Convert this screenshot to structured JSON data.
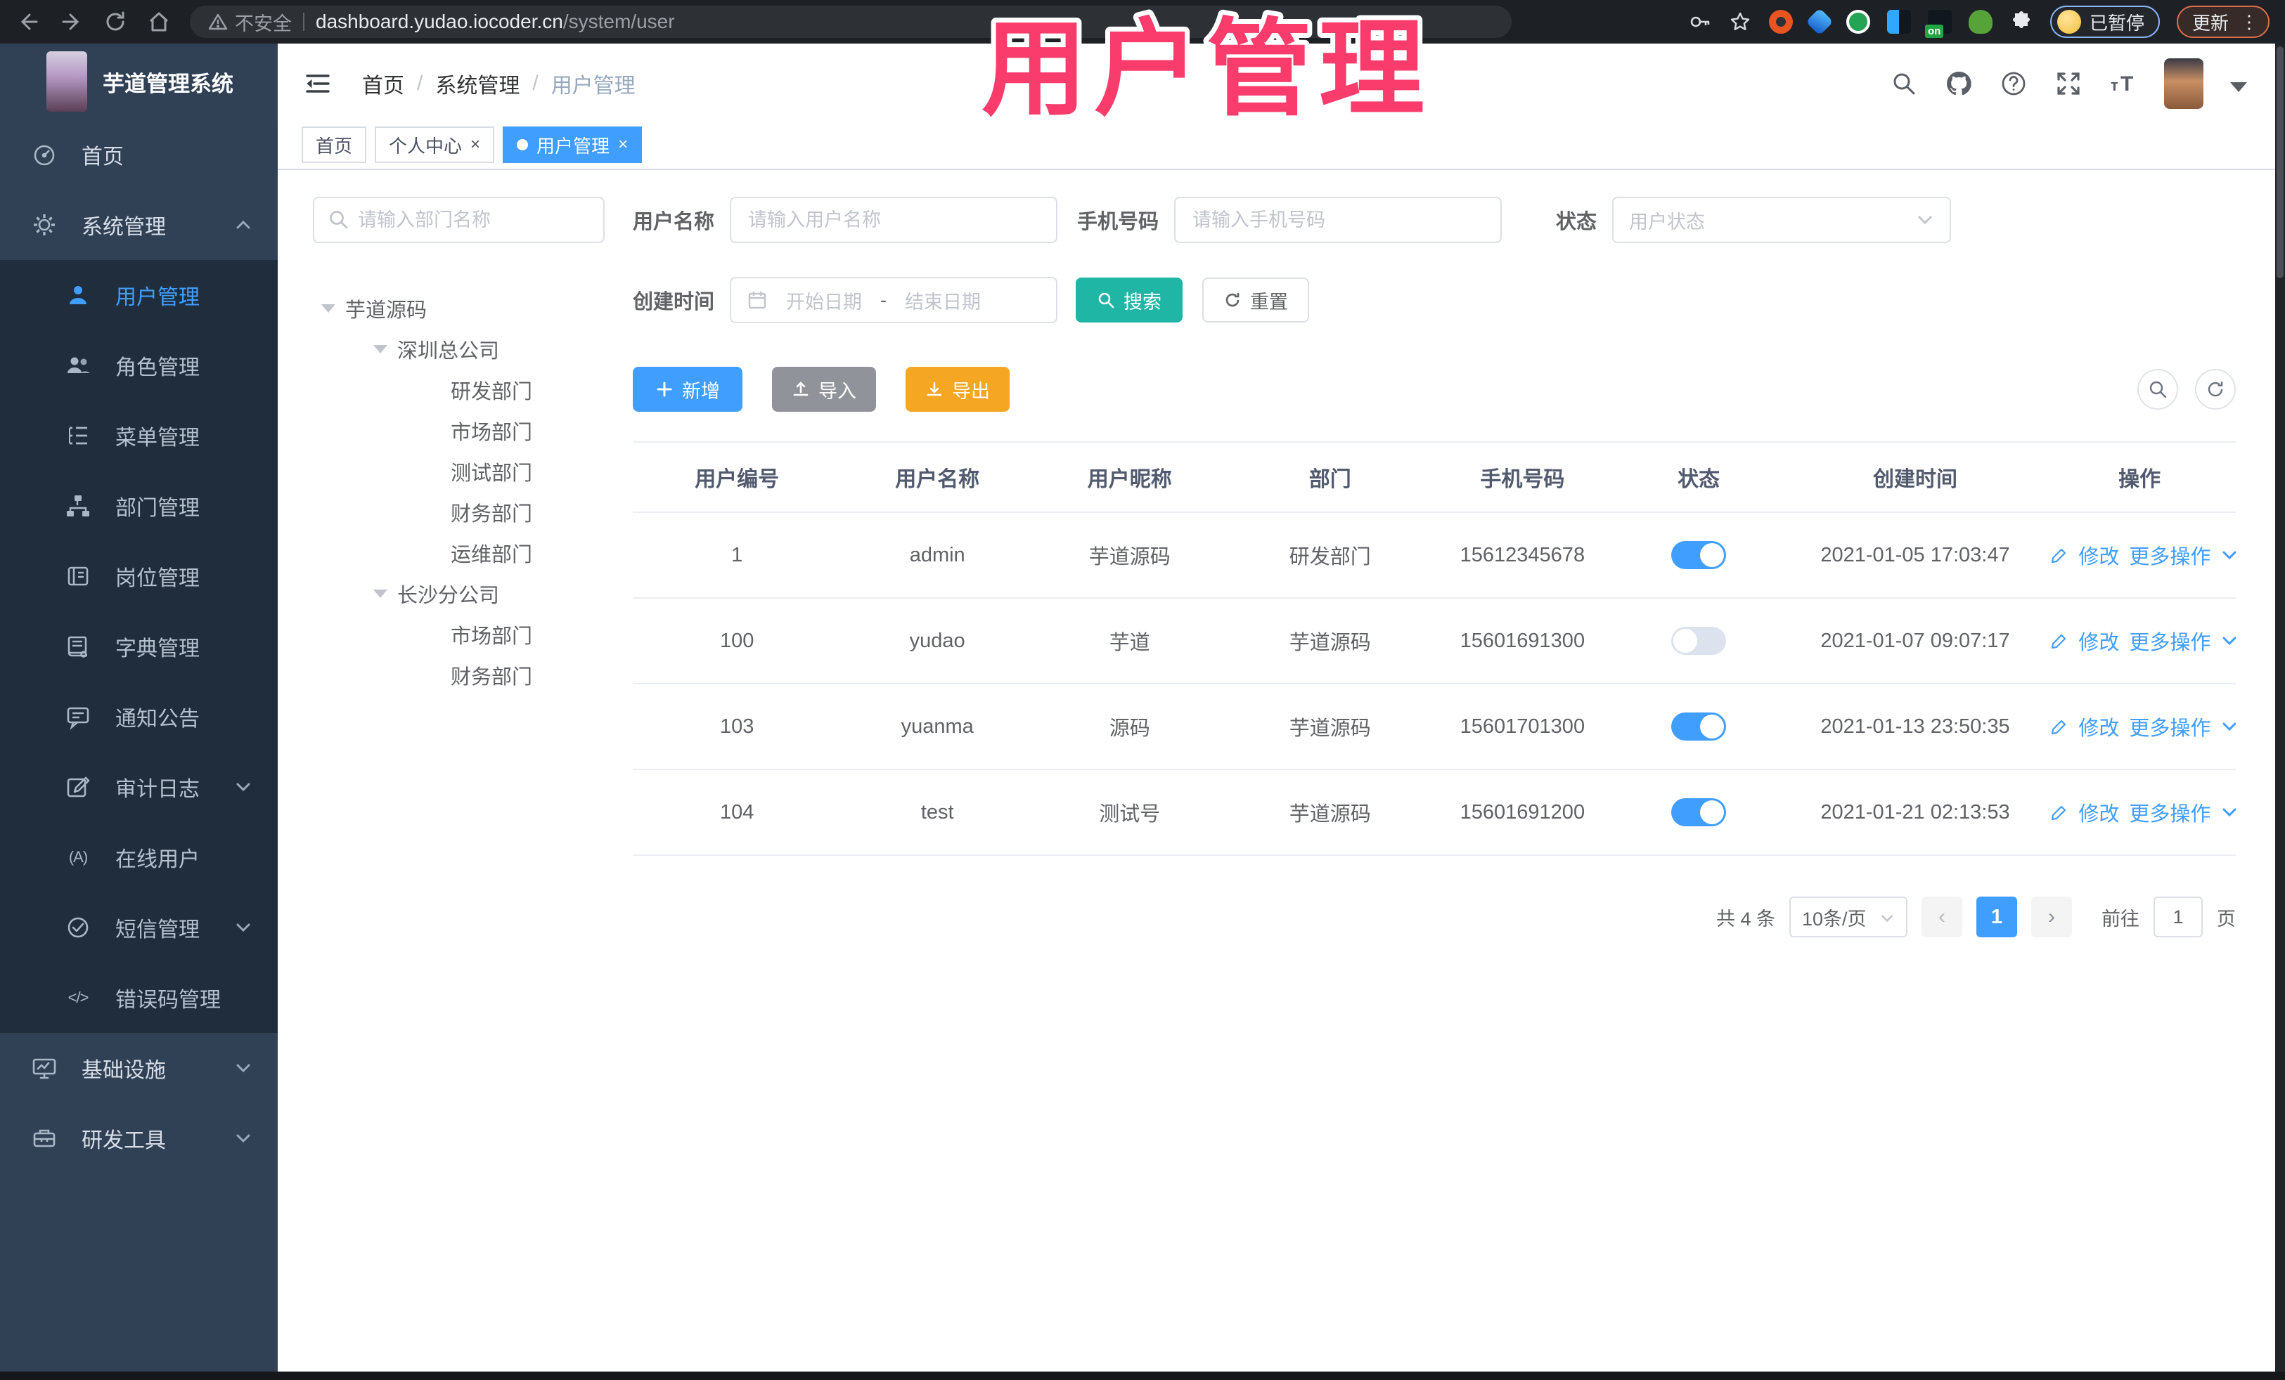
{
  "watermark": "用户管理",
  "browser": {
    "security_label": "不安全",
    "url_host": "dashboard.yudao.iocoder.cn",
    "url_path": "/system/user",
    "extension_on_badge": "on",
    "profile_status": "已暂停",
    "update_label": "更新"
  },
  "sidebar": {
    "title": "芋道管理系统",
    "items": [
      {
        "label": "首页"
      },
      {
        "label": "系统管理"
      },
      {
        "label": "用户管理"
      },
      {
        "label": "角色管理"
      },
      {
        "label": "菜单管理"
      },
      {
        "label": "部门管理"
      },
      {
        "label": "岗位管理"
      },
      {
        "label": "字典管理"
      },
      {
        "label": "通知公告"
      },
      {
        "label": "审计日志"
      },
      {
        "label": "在线用户"
      },
      {
        "label": "短信管理"
      },
      {
        "label": "错误码管理"
      },
      {
        "label": "基础设施"
      },
      {
        "label": "研发工具"
      }
    ],
    "online_icon_text": "(A)",
    "code_icon_text": "</>"
  },
  "header": {
    "breadcrumb": [
      "首页",
      "系统管理",
      "用户管理"
    ],
    "separator": "/"
  },
  "tabs": [
    {
      "label": "首页"
    },
    {
      "label": "个人中心"
    },
    {
      "label": "用户管理"
    }
  ],
  "dept_panel": {
    "search_placeholder": "请输入部门名称",
    "tree": [
      {
        "label": "芋道源码"
      },
      {
        "label": "深圳总公司"
      },
      {
        "label": "研发部门"
      },
      {
        "label": "市场部门"
      },
      {
        "label": "测试部门"
      },
      {
        "label": "财务部门"
      },
      {
        "label": "运维部门"
      },
      {
        "label": "长沙分公司"
      },
      {
        "label": "市场部门"
      },
      {
        "label": "财务部门"
      }
    ]
  },
  "filters": {
    "username_label": "用户名称",
    "username_placeholder": "请输入用户名称",
    "mobile_label": "手机号码",
    "mobile_placeholder": "请输入手机号码",
    "status_label": "状态",
    "status_placeholder": "用户状态",
    "create_time_label": "创建时间",
    "date_start_placeholder": "开始日期",
    "date_separator": "-",
    "date_end_placeholder": "结束日期",
    "search_button": "搜索",
    "reset_button": "重置"
  },
  "toolbar": {
    "add_button": "新增",
    "import_button": "导入",
    "export_button": "导出"
  },
  "table": {
    "columns": [
      "用户编号",
      "用户名称",
      "用户昵称",
      "部门",
      "手机号码",
      "状态",
      "创建时间",
      "操作"
    ],
    "edit_label": "修改",
    "more_label": "更多操作",
    "rows": [
      {
        "id": "1",
        "username": "admin",
        "nickname": "芋道源码",
        "dept": "研发部门",
        "mobile": "15612345678",
        "status_on": true,
        "created": "2021-01-05 17:03:47"
      },
      {
        "id": "100",
        "username": "yudao",
        "nickname": "芋道",
        "dept": "芋道源码",
        "mobile": "15601691300",
        "status_on": false,
        "created": "2021-01-07 09:07:17"
      },
      {
        "id": "103",
        "username": "yuanma",
        "nickname": "源码",
        "dept": "芋道源码",
        "mobile": "15601701300",
        "status_on": true,
        "created": "2021-01-13 23:50:35"
      },
      {
        "id": "104",
        "username": "test",
        "nickname": "测试号",
        "dept": "芋道源码",
        "mobile": "15601691200",
        "status_on": true,
        "created": "2021-01-21 02:13:53"
      }
    ]
  },
  "pagination": {
    "total": "共 4 条",
    "page_size": "10条/页",
    "current_page": "1",
    "goto_label": "前往",
    "goto_value": "1",
    "page_unit": "页"
  },
  "colors": {
    "primary": "#409eff",
    "search_teal": "#1fb6a6",
    "export_orange": "#f5a623",
    "import_gray": "#909399",
    "watermark_pink": "#fa3c6c",
    "sidebar_bg": "#304156",
    "sidebar_submenu_bg": "#1f2d3d"
  }
}
